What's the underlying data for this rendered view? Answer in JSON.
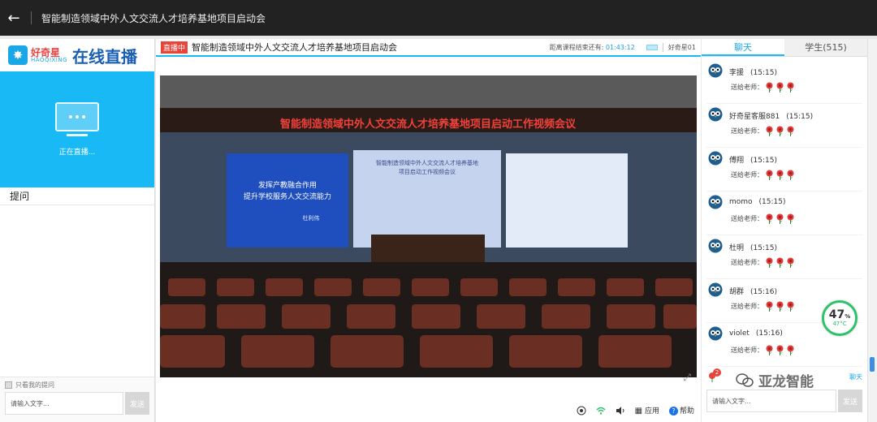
{
  "topbar": {
    "back_icon": "arrow-left-icon",
    "title": "智能制造领域中外人文交流人才培养基地项目启动会"
  },
  "left": {
    "logo_cn": "好奇星",
    "logo_en": "HAOQIXING",
    "logo_live": "在线直播",
    "status": "正在直播...",
    "questions_title": "提问",
    "only_mine": "只看我的提问",
    "input_placeholder": "请输入文字...",
    "send_label": "发送"
  },
  "player": {
    "live_badge": "直播中",
    "title": "智能制造领域中外人文交流人才培养基地项目启动会",
    "countdown_label": "距离课程结束还有:",
    "countdown_value": "01:43:12",
    "username": "好奇星01",
    "banner": "智能制造领域中外人文交流人才培养基地项目启动工作视频会议",
    "screen_left_line1": "发挥产教融合作用",
    "screen_left_line2": "提升学校服务人文交流能力",
    "screen_left_name": "杜利伟",
    "screen_center_line1": "智能制造领域中外人文交流人才培养基地",
    "screen_center_line2": "项目启动工作视频会议",
    "toolbar": {
      "apps_label": "应用",
      "help_label": "帮助"
    }
  },
  "chat": {
    "tab_chat": "聊天",
    "tab_students": "学生(515)",
    "gift_text": "送给老师：",
    "messages": [
      {
        "name": "李援",
        "time": "(15:15)"
      },
      {
        "name": "好奇星客服881",
        "time": "(15:15)"
      },
      {
        "name": "傅翔",
        "time": "(15:15)"
      },
      {
        "name": "momo",
        "time": "(15:15)"
      },
      {
        "name": "杜明",
        "time": "(15:15)"
      },
      {
        "name": "胡群",
        "time": "(15:16)"
      },
      {
        "name": "violet",
        "time": "(15:16)"
      }
    ],
    "badge_count": "2",
    "chat_button": "聊天",
    "input_placeholder": "请输入文字...",
    "send_label": "发送"
  },
  "gauge": {
    "percent": "47",
    "percent_unit": "%",
    "temp": "47°C"
  },
  "watermark": {
    "text": "亚龙智能"
  },
  "colors": {
    "accent": "#19b9f6",
    "live_red": "#e8443a",
    "brand_blue": "#1a5fb4"
  }
}
